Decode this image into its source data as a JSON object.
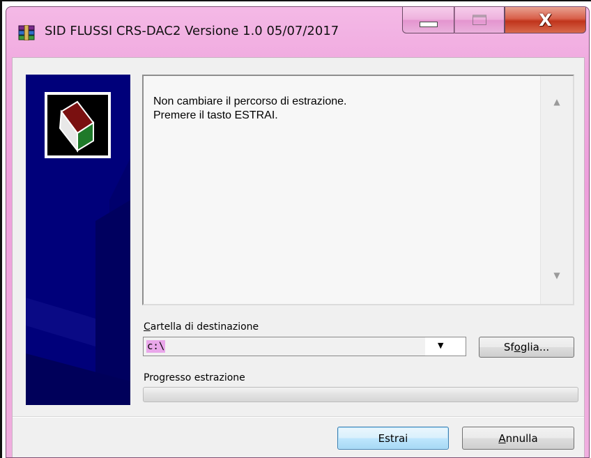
{
  "window": {
    "title": "SID FLUSSI CRS-DAC2 Versione 1.0 05/07/2017",
    "accent_color": "#ee9fdb",
    "icon": "winrar-archive-icon"
  },
  "titlebar": {
    "minimize_icon": "minimize-icon",
    "maximize_icon": "maximize-icon",
    "close_glyph": "X"
  },
  "message": {
    "lines": [
      "Non cambiare il percorso di estrazione.",
      "Premere il tasto ESTRAI."
    ]
  },
  "destination": {
    "label_prefix": "C",
    "label_rest": "artella di destinazione",
    "value": "c:\\"
  },
  "browse_button": {
    "label_prefix": "Sf",
    "label_accel": "o",
    "label_rest": "glia..."
  },
  "progress": {
    "label": "Progresso estrazione",
    "value": 0
  },
  "footer": {
    "extract_label": "Estrai",
    "cancel_label_accel": "A",
    "cancel_label_rest": "nnulla"
  },
  "side_panel": {
    "color": "#00006d",
    "logo_icon": "installer-box-icon"
  }
}
